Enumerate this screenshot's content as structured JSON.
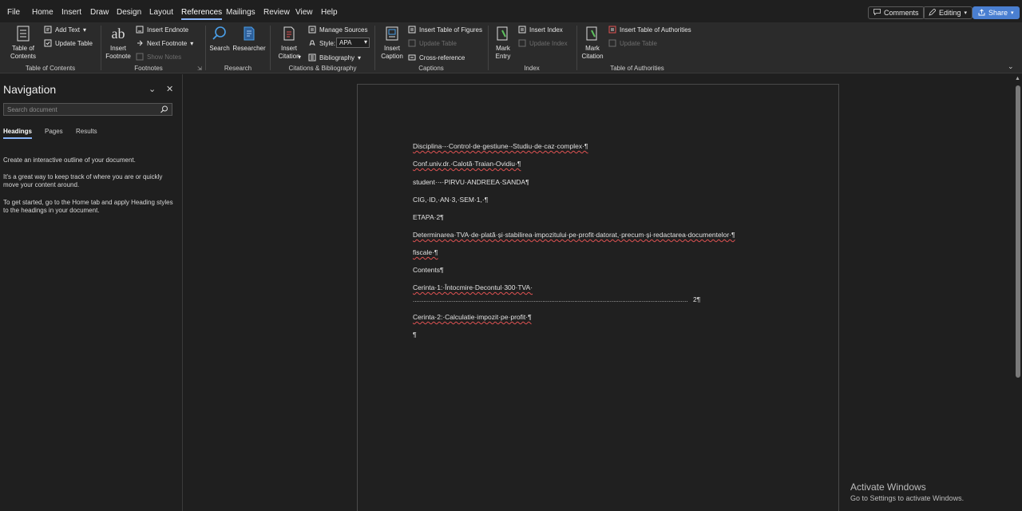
{
  "menu": {
    "tabs": [
      "File",
      "Home",
      "Insert",
      "Draw",
      "Design",
      "Layout",
      "References",
      "Mailings",
      "Review",
      "View",
      "Help"
    ],
    "active_tab": "References",
    "comments_label": "Comments",
    "editing_label": "Editing",
    "share_label": "Share"
  },
  "ribbon": {
    "toc": {
      "table_of_contents": "Table of Contents",
      "add_text": "Add Text",
      "update_table": "Update Table",
      "group": "Table of Contents"
    },
    "footnotes": {
      "insert_footnote": "Insert Footnote",
      "insert_endnote": "Insert Endnote",
      "next_footnote": "Next Footnote",
      "show_notes": "Show Notes",
      "group": "Footnotes"
    },
    "research": {
      "search": "Search",
      "researcher": "Researcher",
      "group": "Research"
    },
    "citations": {
      "insert_citation": "Insert Citation",
      "manage_sources": "Manage Sources",
      "style_label": "Style:",
      "style_value": "APA",
      "bibliography": "Bibliography",
      "group": "Citations & Bibliography"
    },
    "captions": {
      "insert_caption": "Insert Caption",
      "insert_table_of_figures": "Insert Table of Figures",
      "update_table": "Update Table",
      "cross_reference": "Cross-reference",
      "group": "Captions"
    },
    "index": {
      "mark_entry": "Mark Entry",
      "insert_index": "Insert Index",
      "update_index": "Update Index",
      "group": "Index"
    },
    "authorities": {
      "mark_citation": "Mark Citation",
      "insert_table_of_authorities": "Insert Table of Authorities",
      "update_table": "Update Table",
      "group": "Table of Authorities"
    }
  },
  "navigation": {
    "title": "Navigation",
    "search_placeholder": "Search document",
    "tabs": [
      "Headings",
      "Pages",
      "Results"
    ],
    "active_tab": "Headings",
    "help": [
      "Create an interactive outline of your document.",
      "It's a great way to keep track of where you are or quickly move your content around.",
      "To get started, go to the Home tab and apply Heading styles to the headings in your document."
    ]
  },
  "document": {
    "lines": [
      "Disciplina·-·Control·de·gestiune·-Studiu·de·caz·complex·¶",
      "Conf.univ.dr.·Calotă·Traian-Ovidiu·¶",
      "student··-·PIRVU·ANDREEA·SANDA¶",
      "CIG,·ID,·AN·3,·SEM·1,·¶",
      "ETAPA·2¶",
      "Determinarea·TVA·de·plată·și·stabilirea·impozitului·pe·profit·datorat,·precum·și·redactarea·documentelor·¶",
      "fiscale·¶",
      "Contents¶",
      "Cerinta·1:·Întocmire·Decontul·300·TVA·",
      "Cerinta·2:·Calculatie·impozit·pe·profit·¶",
      "¶"
    ],
    "toc_page": "2¶"
  },
  "watermark": {
    "title": "Activate Windows",
    "subtitle": "Go to Settings to activate Windows."
  }
}
